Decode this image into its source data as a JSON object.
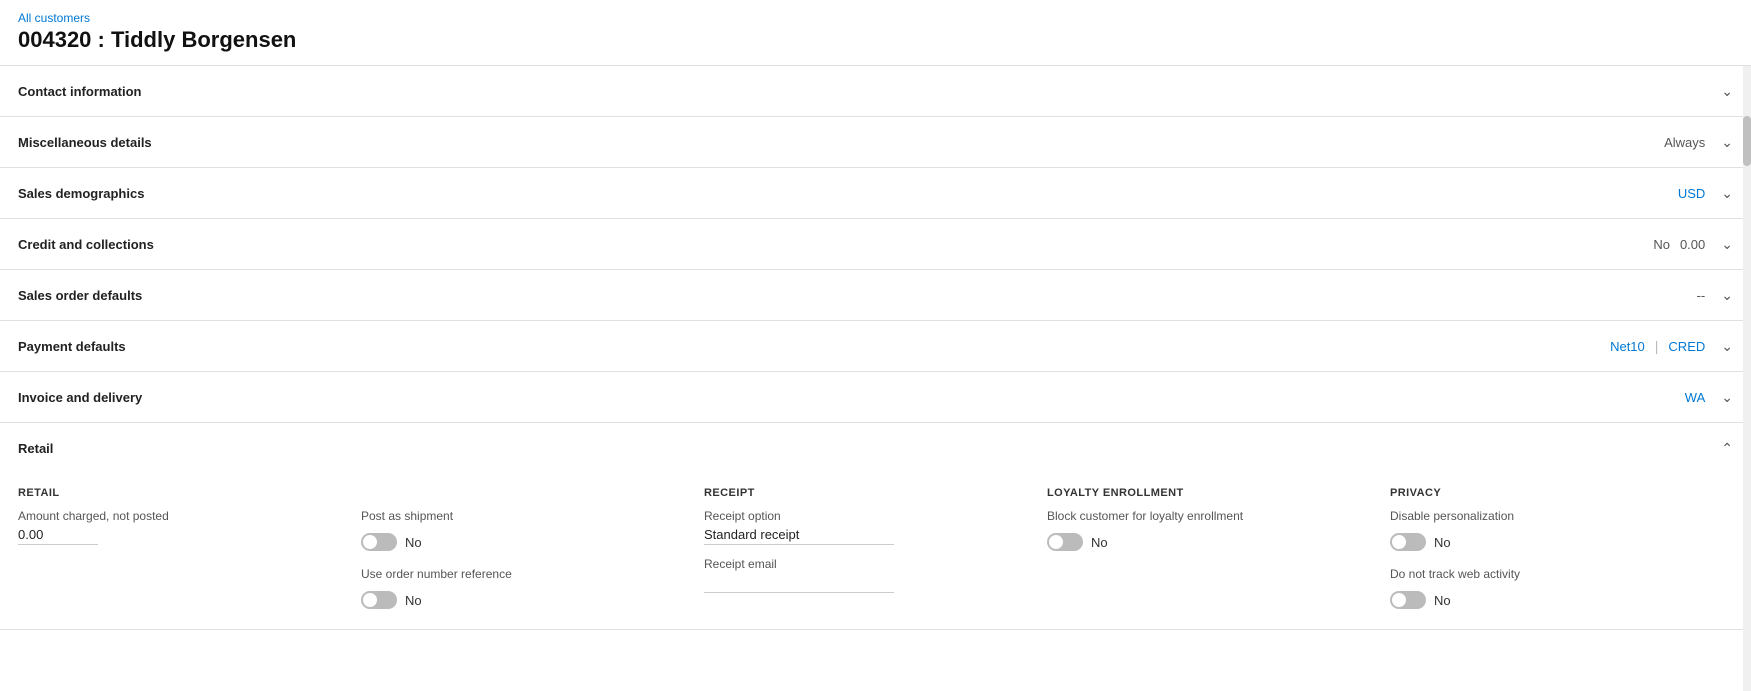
{
  "breadcrumb": "All customers",
  "page_title": "004320 : Tiddly Borgensen",
  "sections": [
    {
      "id": "contact-information",
      "title": "Contact information",
      "meta": [],
      "collapsed": true,
      "chevron": "down"
    },
    {
      "id": "miscellaneous-details",
      "title": "Miscellaneous details",
      "meta": [
        {
          "value": "Always",
          "class": ""
        }
      ],
      "collapsed": true,
      "chevron": "down"
    },
    {
      "id": "sales-demographics",
      "title": "Sales demographics",
      "meta": [
        {
          "value": "USD",
          "class": "blue"
        }
      ],
      "collapsed": true,
      "chevron": "down"
    },
    {
      "id": "credit-and-collections",
      "title": "Credit and collections",
      "meta": [
        {
          "value": "No",
          "class": ""
        },
        {
          "value": "0.00",
          "class": ""
        }
      ],
      "collapsed": true,
      "chevron": "down"
    },
    {
      "id": "sales-order-defaults",
      "title": "Sales order defaults",
      "meta": [
        {
          "value": "--",
          "class": ""
        }
      ],
      "collapsed": true,
      "chevron": "down"
    },
    {
      "id": "payment-defaults",
      "title": "Payment defaults",
      "meta": [
        {
          "value": "Net10",
          "class": "blue"
        },
        {
          "value": "|",
          "class": "pipe"
        },
        {
          "value": "CRED",
          "class": "blue"
        }
      ],
      "collapsed": true,
      "chevron": "down"
    },
    {
      "id": "invoice-and-delivery",
      "title": "Invoice and delivery",
      "meta": [
        {
          "value": "WA",
          "class": "blue"
        }
      ],
      "collapsed": true,
      "chevron": "down"
    },
    {
      "id": "retail",
      "title": "Retail",
      "meta": [],
      "collapsed": false,
      "chevron": "up"
    }
  ],
  "retail": {
    "col1": {
      "label": "RETAIL",
      "field1_label": "Amount charged, not posted",
      "field1_value": "0.00"
    },
    "col2": {
      "label": "",
      "toggle1_label": "Post as shipment",
      "toggle1_value": "No",
      "toggle1_on": false,
      "toggle2_label": "Use order number reference",
      "toggle2_value": "No",
      "toggle2_on": false
    },
    "col3": {
      "label": "RECEIPT",
      "field1_label": "Receipt option",
      "field1_value": "Standard receipt",
      "field2_label": "Receipt email",
      "field2_value": ""
    },
    "col4": {
      "label": "LOYALTY ENROLLMENT",
      "toggle1_label": "Block customer for loyalty enrollment",
      "toggle1_value": "No",
      "toggle1_on": false
    },
    "col5": {
      "label": "PRIVACY",
      "toggle1_label": "Disable personalization",
      "toggle1_value": "No",
      "toggle1_on": false,
      "toggle2_label": "Do not track web activity",
      "toggle2_value": "No",
      "toggle2_on": false
    }
  }
}
